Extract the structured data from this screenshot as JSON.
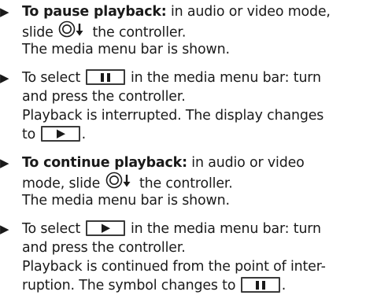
{
  "items": [
    {
      "lead": "To pause playback:",
      "text1": "in audio or video mode,",
      "text2a": "slide",
      "text2b": "the controller.",
      "result": "The media menu bar is shown."
    },
    {
      "text1a": "To select",
      "text1b": "in the media menu bar: turn",
      "text2": "and press the controller.",
      "result1": "Playback is interrupted. The display changes",
      "result2a": "to",
      "result2b": "."
    },
    {
      "lead": "To continue playback:",
      "text1": "in audio or video",
      "text2a": "mode, slide",
      "text2b": "the controller.",
      "result": "The media menu bar is shown."
    },
    {
      "text1a": "To select",
      "text1b": "in the media menu bar: turn",
      "text2": "and press the controller.",
      "result1": "Playback is continued from the point of inter-",
      "result2a": "ruption. The symbol changes to",
      "result2b": "."
    }
  ],
  "icons": {
    "bullet": "triangle-bullet-icon",
    "controller": "controller-slide-down-icon",
    "pause": "pause-icon",
    "play": "play-icon"
  }
}
